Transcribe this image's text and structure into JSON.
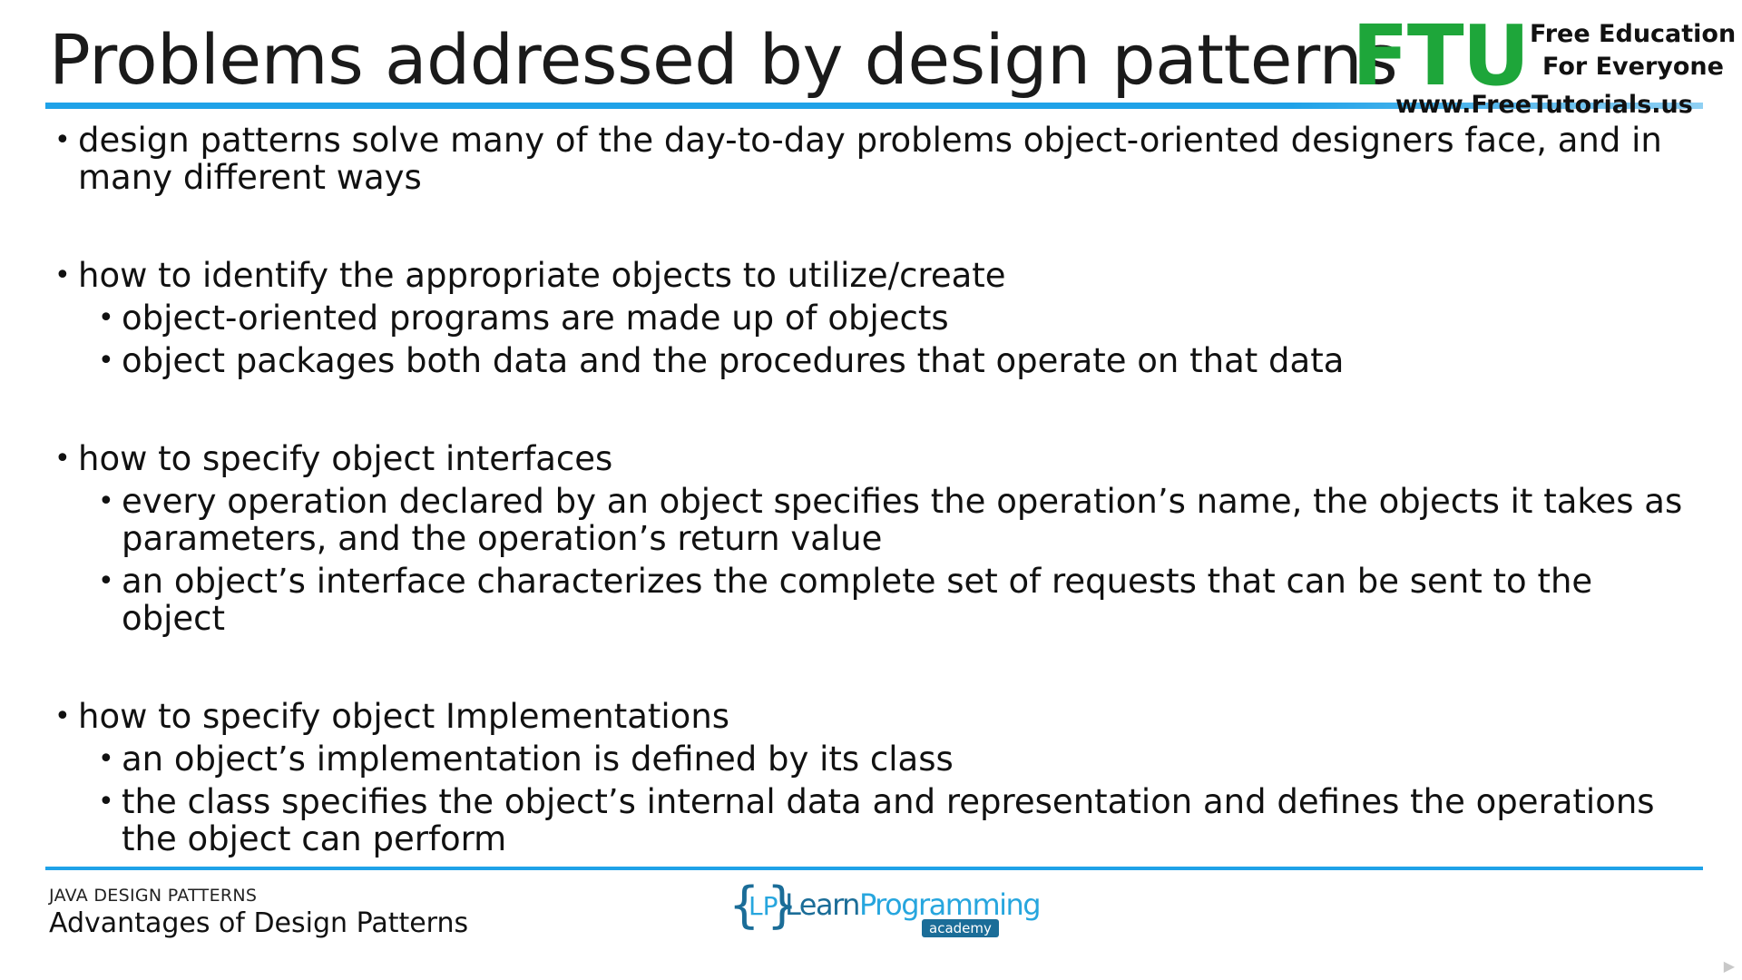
{
  "slide": {
    "title": "Problems addressed by design patterns"
  },
  "watermark": {
    "brand": "FTU",
    "tagline_1": "Free Education",
    "tagline_2": "For Everyone",
    "url": "www.FreeTutorials.us"
  },
  "bullets": [
    {
      "text": "design patterns solve many of the day-to-day problems object-oriented designers face, and in many different ways",
      "sub": []
    },
    {
      "text": "how to identify the appropriate objects to utilize/create",
      "sub": [
        "object-oriented programs are made up of objects",
        "object packages both data and the procedures that operate on that data"
      ]
    },
    {
      "text": "how to specify object interfaces",
      "sub": [
        "every operation declared by an object specifies the operation’s name, the objects it takes as parameters, and the operation’s return value",
        "an object’s interface characterizes the complete set of requests that can be sent to the object"
      ]
    },
    {
      "text": "how to specify object Implementations",
      "sub": [
        "an object’s implementation is defined by its class",
        "the class specifies the object’s internal data and representation and defines the operations the object can perform"
      ]
    }
  ],
  "bullet_glyph": "•",
  "footer": {
    "course": "JAVA DESIGN PATTERNS",
    "lecture": "Advantages of Design Patterns",
    "logo": {
      "brace_open": "{",
      "monogram": "LP",
      "brace_close": "}",
      "word_part_1": "Learn",
      "word_part_2": "Programming",
      "badge": "academy"
    }
  },
  "colors": {
    "accent_blue": "#1fa2e8",
    "ftu_green": "#1ea63a",
    "lp_dark_blue": "#1b6d98",
    "lp_light_blue": "#27a6de"
  }
}
